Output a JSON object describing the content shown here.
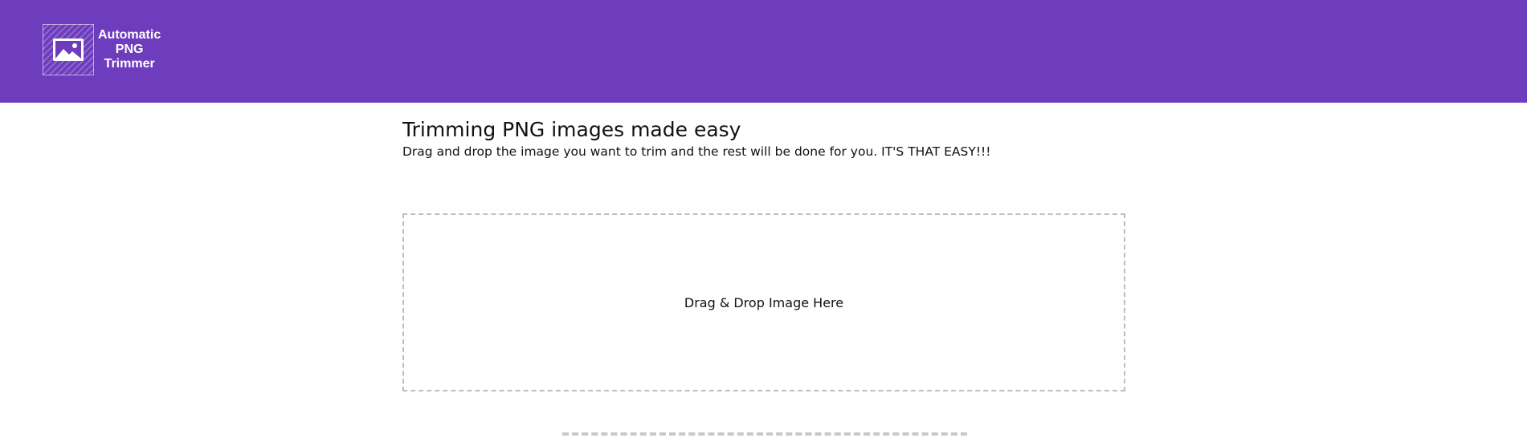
{
  "header": {
    "logo": {
      "icon": "image-icon",
      "line1": "Automatic",
      "line2": "PNG",
      "line3": "Trimmer"
    },
    "background_color": "#6e3dbd"
  },
  "main": {
    "title": "Trimming PNG images made easy",
    "subtitle": "Drag and drop the image you want to trim and the rest will be done for you. IT'S THAT EASY!!!"
  },
  "dropzone": {
    "label": "Drag & Drop Image Here"
  }
}
